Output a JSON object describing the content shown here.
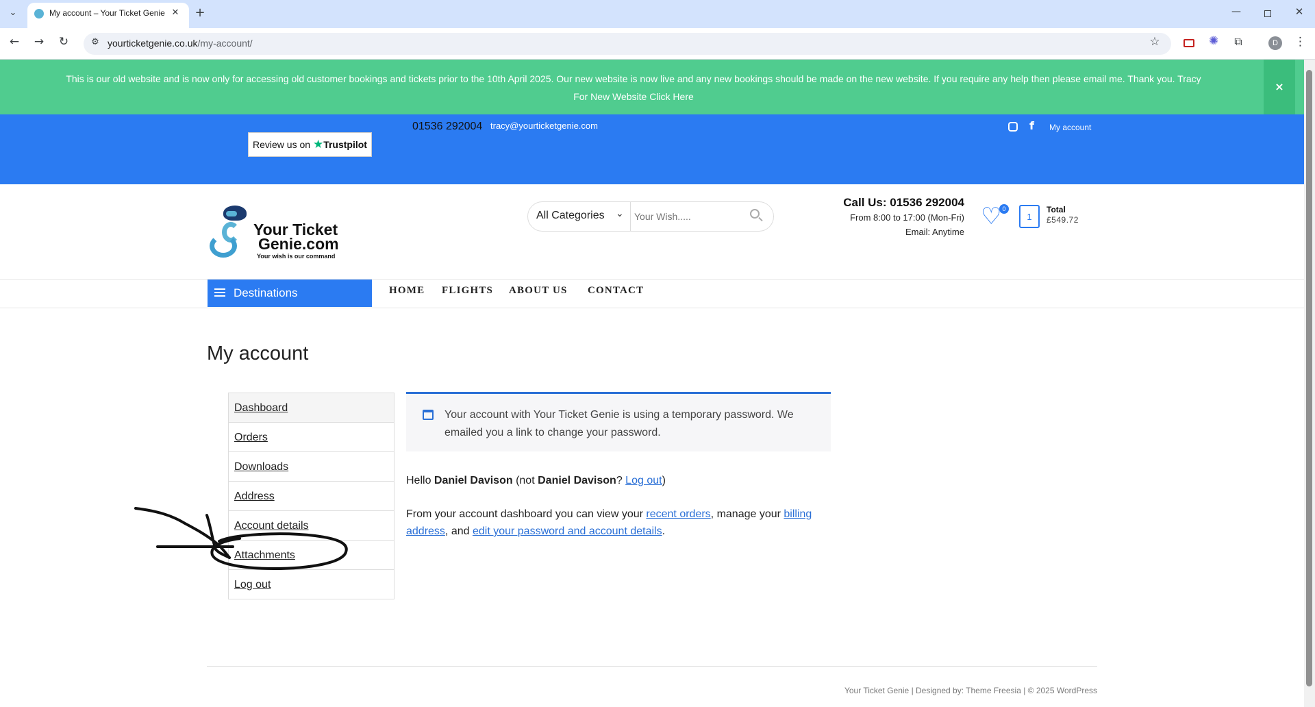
{
  "browser": {
    "tab_title": "My account – Your Ticket Genie",
    "url_host": "yourticketgenie.co.uk",
    "url_path": "/my-account/",
    "profile_initial": "D"
  },
  "notice": {
    "text": "This is our old website and is now only for accessing old customer bookings and tickets prior to the 10th April 2025. Our new website is now live and any new bookings should be made on the new website. If you require any help then please email me. Thank you. Tracy",
    "link": "For New Website Click Here",
    "close": "×"
  },
  "topbar": {
    "trustpilot_prefix": "Review us on",
    "trustpilot_brand": "Trustpilot",
    "phone": "01536 292004",
    "email": "tracy@yourticketgenie.com",
    "my_account": "My account"
  },
  "header": {
    "logo_line1": "Your Ticket",
    "logo_line2": "Genie.com",
    "logo_tagline": "Your wish is our command",
    "category_select": "All Categories",
    "search_placeholder": "Your Wish.....",
    "call_us": "Call Us: 01536 292004",
    "hours": "From 8:00 to 17:00 (Mon-Fri)",
    "email_line": "Email: Anytime",
    "wishlist_count": "0",
    "cart_count": "1",
    "total_label": "Total",
    "total_value": "£549.72"
  },
  "nav": {
    "destinations": "Destinations",
    "items": [
      "HOME",
      "FLIGHTS",
      "ABOUT US",
      "CONTACT"
    ]
  },
  "page": {
    "title": "My account",
    "account_nav": [
      "Dashboard",
      "Orders",
      "Downloads",
      "Address",
      "Account details",
      "Attachments",
      "Log out"
    ],
    "info_message": "Your account with Your Ticket Genie is using a temporary password. We emailed you a link to change your password.",
    "hello_prefix": "Hello",
    "user_name": "Daniel Davison",
    "not_prefix": "(not",
    "q_mark": "?",
    "logout_link": "Log out",
    "close_paren": ")",
    "dash_text1": "From your account dashboard you can view your",
    "recent_orders": "recent orders",
    "dash_text2": ", manage your",
    "billing_1": "billing",
    "billing_2": "address",
    "dash_text3": ", and",
    "edit_link": "edit your password and account details",
    "period": "."
  },
  "footer": {
    "text": "Your Ticket Genie | Designed by: Theme Freesia | © 2025 WordPress"
  },
  "colors": {
    "notice_green": "#50cc8f",
    "topbar_blue": "#2b7bf2",
    "link_blue": "#2a6fd6"
  }
}
